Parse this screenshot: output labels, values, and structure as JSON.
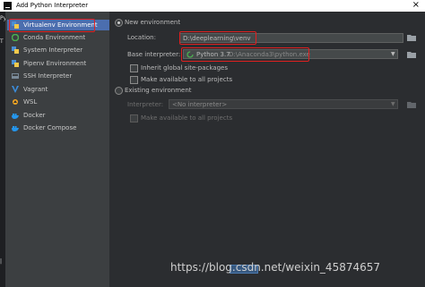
{
  "window": {
    "title": "Add Python Interpreter",
    "close_glyph": "×"
  },
  "left_strip": {
    "marks": [
      "Py",
      "T",
      "|"
    ]
  },
  "sidebar": {
    "items": [
      {
        "label": "Virtualenv Environment",
        "icon": "virtualenv-icon",
        "selected": true
      },
      {
        "label": "Conda Environment",
        "icon": "conda-icon"
      },
      {
        "label": "System Interpreter",
        "icon": "python-icon"
      },
      {
        "label": "Pipenv Environment",
        "icon": "pipenv-icon"
      },
      {
        "label": "SSH Interpreter",
        "icon": "ssh-icon"
      },
      {
        "label": "Vagrant",
        "icon": "vagrant-icon"
      },
      {
        "label": "WSL",
        "icon": "wsl-icon"
      },
      {
        "label": "Docker",
        "icon": "docker-icon"
      },
      {
        "label": "Docker Compose",
        "icon": "docker-compose-icon"
      }
    ]
  },
  "new_env": {
    "radio_label": "New environment",
    "location_label": "Location:",
    "location_value": "D:\\deeplearning\\venv",
    "base_label": "Base interpreter:",
    "base_name": "Python 3.7",
    "base_path": "D:\\Anaconda3\\python.exe",
    "inherit_label": "Inherit global site-packages",
    "available_label": "Make available to all projects"
  },
  "existing_env": {
    "radio_label": "Existing environment",
    "interpreter_label": "Interpreter:",
    "interpreter_value": "<No interpreter>",
    "available_label": "Make available to all projects"
  },
  "watermark": "https://blog.csdn.net/weixin_45874657",
  "colors": {
    "selection": "#4b6eaf",
    "highlight": "#e02020",
    "background": "#2b2d30",
    "sidebar": "#3c3f41"
  }
}
